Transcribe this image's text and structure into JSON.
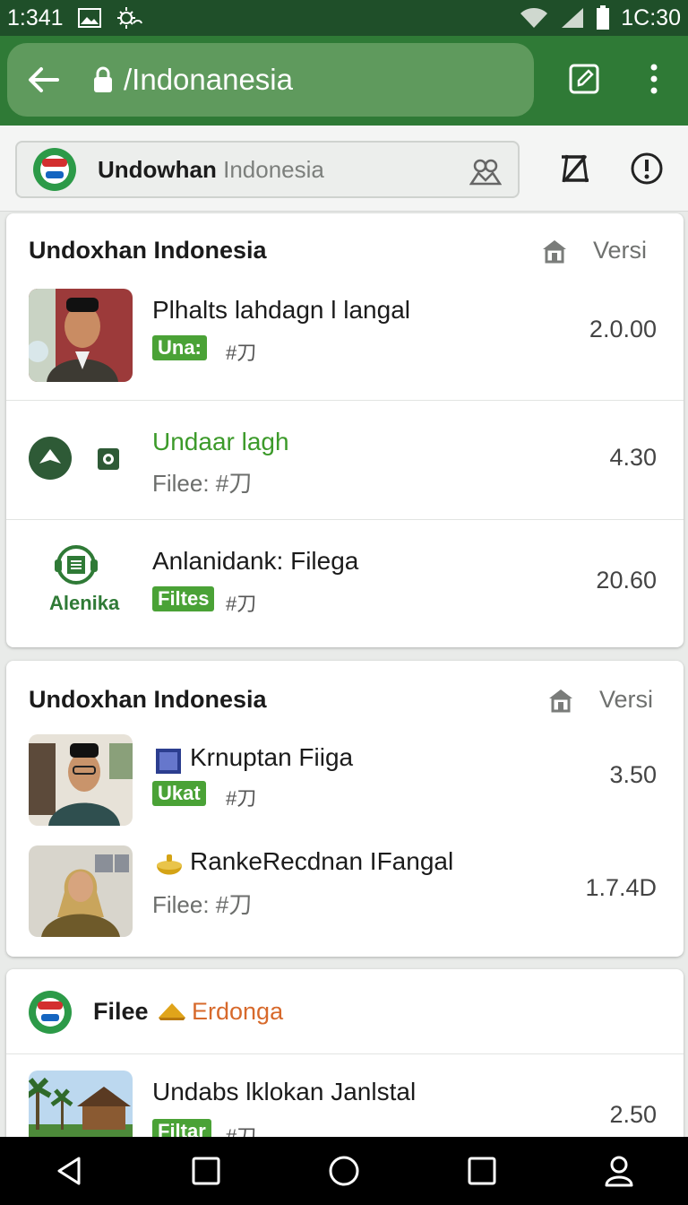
{
  "status_bar": {
    "time_left": "1:341",
    "time_right": "1C:30",
    "icons": [
      "image-icon",
      "weather-icon",
      "wifi-icon",
      "signal-icon",
      "battery-icon"
    ]
  },
  "browser": {
    "url": "/Indonanesia",
    "back_icon": "arrow-left-icon",
    "edit_icon": "edit-icon",
    "menu_icon": "more-vert-icon"
  },
  "app_search": {
    "brand_bold": "Undowhan",
    "brand_muted": "Indonesia"
  },
  "sections": [
    {
      "title": "Undoxhan Indonesia",
      "versi_label": "Versi",
      "items": [
        {
          "title": "Plhalts lahdagn l langal",
          "badge": "Una:",
          "meta": "#刀",
          "version": "2.0.00"
        },
        {
          "title": "Undaar lagh",
          "sub": "Filee: #刀",
          "version": "4.30"
        },
        {
          "logo_text": "Alenika",
          "title": "Anlanidank: Filega",
          "badge": "Filtes",
          "meta": "#刀",
          "version": "20.60"
        }
      ]
    },
    {
      "title": "Undoxhan Indonesia",
      "versi_label": "Versi",
      "items": [
        {
          "title": "Krnuptan Fiiga",
          "badge": "Ukat",
          "meta": "#刀",
          "version": "3.50"
        },
        {
          "title": "RankeRecdnan IFangal",
          "sub": "Filee: #刀",
          "version": "1.7.4D"
        }
      ]
    },
    {
      "title_bold": "Filee",
      "title_colored": "Erdonga",
      "items": [
        {
          "title": "Undabs lklokan Janlstal",
          "badge": "Filtar",
          "meta": "#刀",
          "version": "2.50"
        }
      ]
    }
  ],
  "colors": {
    "status_bar": "#1f4f29",
    "toolbar": "#2f7a36",
    "url_pill": "#5f9a5d",
    "badge": "#4aa236",
    "accent_orange": "#d7692b"
  }
}
